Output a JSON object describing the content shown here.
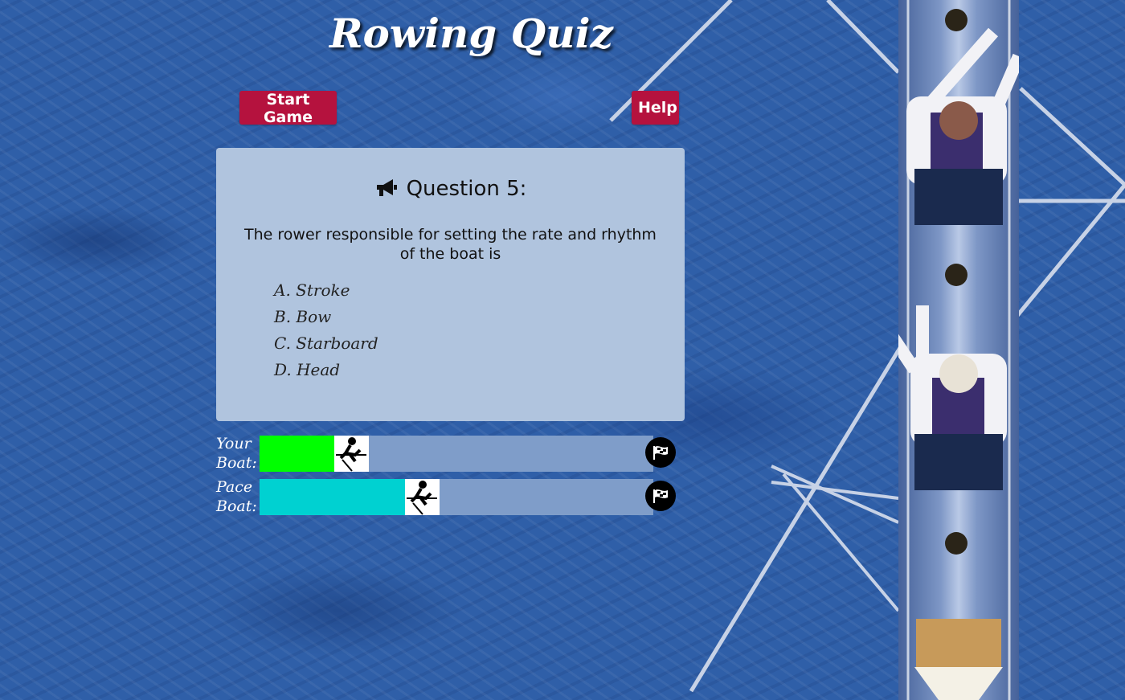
{
  "header": {
    "title": "Rowing Quiz"
  },
  "controls": {
    "start_label": "Start Game",
    "help_label": "Help"
  },
  "question": {
    "heading": "Question 5:",
    "text": "The rower responsible for setting the rate and rhythm of the boat is",
    "answers": [
      "A. Stroke",
      "B. Bow",
      "C. Starboard",
      "D. Head"
    ]
  },
  "race": {
    "your": {
      "label_line1": "Your",
      "label_line2": "Boat:",
      "progress": 0.19,
      "color": "#00ff00"
    },
    "pace": {
      "label_line1": "Pace",
      "label_line2": "Boat:",
      "progress": 0.37,
      "color": "#00d1d1"
    }
  },
  "colors": {
    "accent": "#b5123e",
    "card_bg": "#b0c4de",
    "track": "#7f9dc9"
  },
  "icons": {
    "question": "megaphone-icon",
    "boat": "rowing-icon",
    "finish": "checkered-flag-icon"
  }
}
